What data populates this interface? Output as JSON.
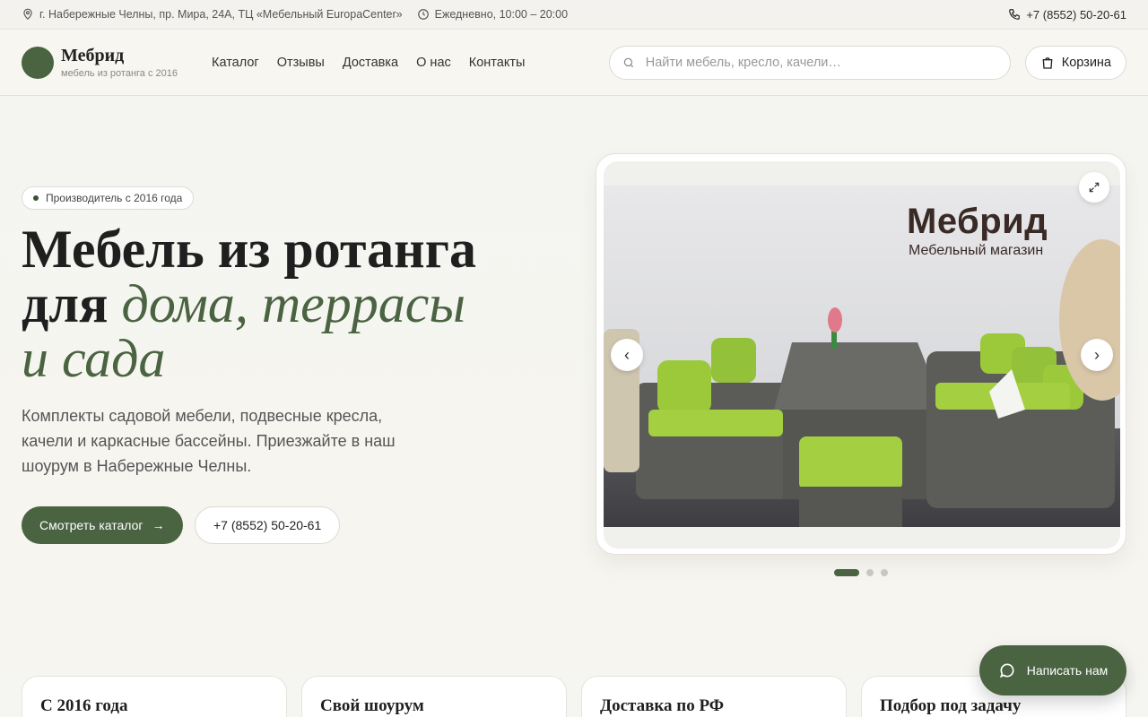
{
  "topbar": {
    "address": "г. Набережные Челны, пр. Мира, 24А, ТЦ «Мебельный EuropaCenter»",
    "hours": "Ежедневно, 10:00 – 20:00",
    "phone": "+7 (8552) 50-20-61"
  },
  "header": {
    "brand_name": "Мебрид",
    "brand_tagline": "мебель из ротанга с 2016",
    "nav": [
      "Каталог",
      "Отзывы",
      "Доставка",
      "О нас",
      "Контакты"
    ],
    "search_placeholder": "Найти мебель, кресло, качели…",
    "cart_label": "Корзина"
  },
  "hero": {
    "badge": "Производитель с 2016 года",
    "title_line1": "Мебель из ротанга",
    "title_line2_plain": "для ",
    "title_line2_accent": "дома, террасы",
    "title_line3_accent": "и сада",
    "description": "Комплекты садовой мебели, подвесные кресла, качели и каркасные бассейны. Приезжайте в наш шоурум в Набережные Челны.",
    "primary_button": "Смотреть каталог",
    "primary_arrow": "→",
    "secondary_button": "+7 (8552) 50-20-61"
  },
  "slider": {
    "photo_title": "Мебрид",
    "photo_subtitle": "Мебельный магазин",
    "prev_glyph": "‹",
    "next_glyph": "›",
    "slide_count": 3,
    "active_index": 0
  },
  "features": [
    "С 2016 года",
    "Свой шоурум",
    "Доставка по РФ",
    "Подбор под задачу"
  ],
  "chat_label": "Написать нам",
  "colors": {
    "accent": "#4a6340",
    "background": "#f5f5f1"
  }
}
